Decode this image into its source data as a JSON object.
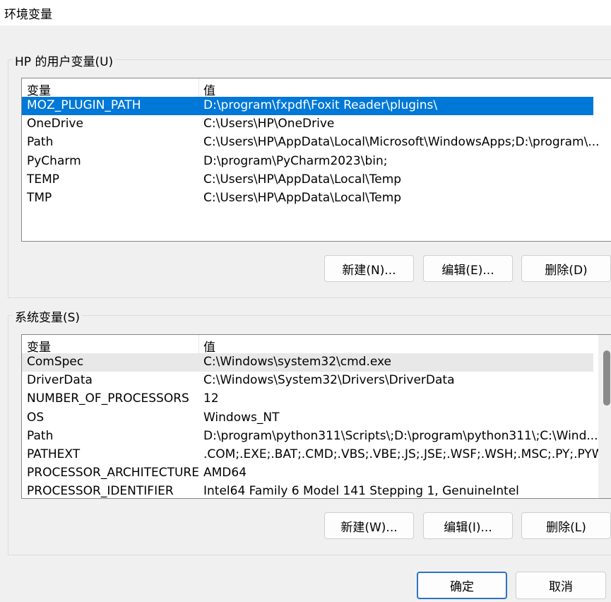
{
  "window": {
    "title": "环境变量"
  },
  "user_vars": {
    "group_label": "HP 的用户变量(U)",
    "headers": [
      "变量",
      "值"
    ],
    "rows": [
      {
        "name": "MOZ_PLUGIN_PATH",
        "value": "D:\\program\\fxpdf\\Foxit Reader\\plugins\\"
      },
      {
        "name": "OneDrive",
        "value": "C:\\Users\\HP\\OneDrive"
      },
      {
        "name": "Path",
        "value": "C:\\Users\\HP\\AppData\\Local\\Microsoft\\WindowsApps;D:\\program\\..."
      },
      {
        "name": "PyCharm",
        "value": "D:\\program\\PyCharm2023\\bin;"
      },
      {
        "name": "TEMP",
        "value": "C:\\Users\\HP\\AppData\\Local\\Temp"
      },
      {
        "name": "TMP",
        "value": "C:\\Users\\HP\\AppData\\Local\\Temp"
      }
    ],
    "selected_row": "MOZ_PLUGIN_PATH",
    "buttons": {
      "new": "新建(N)...",
      "edit": "编辑(E)...",
      "delete": "删除(D)"
    }
  },
  "system_vars": {
    "group_label": "系统变量(S)",
    "headers": [
      "变量",
      "值"
    ],
    "rows": [
      {
        "name": "ComSpec",
        "value": "C:\\Windows\\system32\\cmd.exe"
      },
      {
        "name": "DriverData",
        "value": "C:\\Windows\\System32\\Drivers\\DriverData"
      },
      {
        "name": "NUMBER_OF_PROCESSORS",
        "value": "12"
      },
      {
        "name": "OS",
        "value": "Windows_NT"
      },
      {
        "name": "Path",
        "value": "D:\\program\\python311\\Scripts\\;D:\\program\\python311\\;C:\\Wind..."
      },
      {
        "name": "PATHEXT",
        "value": ".COM;.EXE;.BAT;.CMD;.VBS;.VBE;.JS;.JSE;.WSF;.WSH;.MSC;.PY;.PYW"
      },
      {
        "name": "PROCESSOR_ARCHITECTURE",
        "value": "AMD64"
      },
      {
        "name": "PROCESSOR_IDENTIFIER",
        "value": "Intel64 Family 6 Model 141 Stepping 1, GenuineIntel"
      }
    ],
    "hovered_row": "ComSpec",
    "buttons": {
      "new": "新建(W)...",
      "edit": "编辑(I)...",
      "delete": "删除(L)"
    }
  },
  "dialog_buttons": {
    "ok": "确定",
    "cancel": "取消"
  },
  "colors": {
    "selection": "#0078d7",
    "primary_border": "#2b73c6"
  }
}
